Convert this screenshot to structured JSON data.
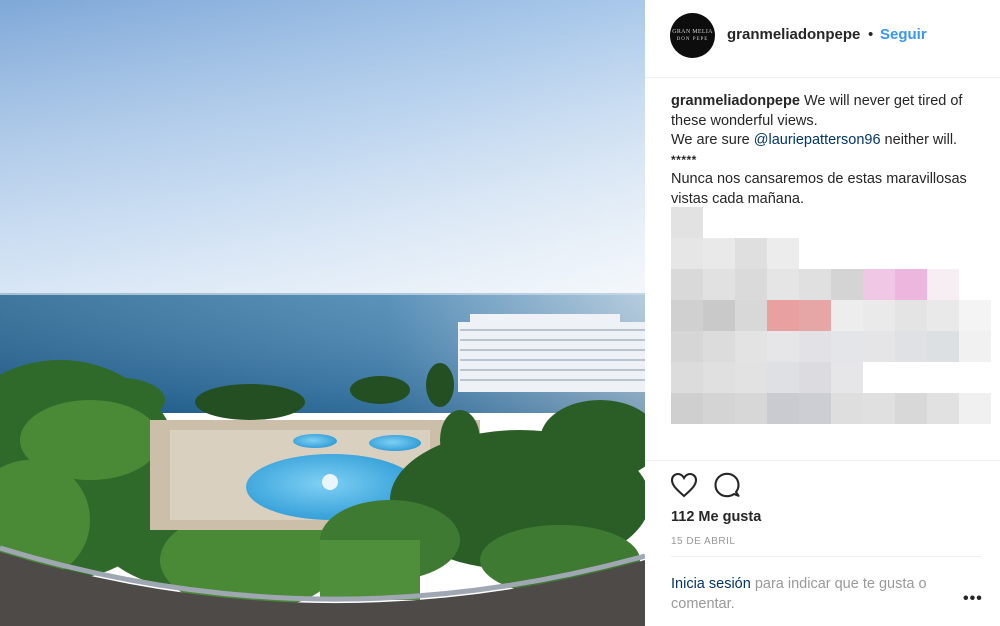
{
  "post": {
    "account": {
      "username": "granmeliadonpepe",
      "avatar_line1": "GRAN MELIA",
      "avatar_line2": "DON PEPE",
      "separator": "•",
      "follow_label": "Seguir"
    },
    "caption": {
      "username": "granmeliadonpepe",
      "line1": " We will never get tired of these wonderful views.",
      "line2_before": "We are sure ",
      "mention": "@lauriepatterson96",
      "line2_after": " neither will.",
      "stars": "*****",
      "line3": "Nunca nos cansaremos de estas maravillosas vistas cada mañana."
    },
    "actions": {
      "like_icon": "heart-icon",
      "comment_icon": "comment-icon",
      "likes_text": "112 Me gusta",
      "date": "15 DE ABRIL"
    },
    "login_prompt": {
      "link": "Inicia sesión",
      "rest": " para indicar que te gusta o comentar."
    },
    "more_options": "•••"
  },
  "colors": {
    "link_blue": "#3897f0",
    "mention_navy": "#003569",
    "muted": "#999999"
  }
}
